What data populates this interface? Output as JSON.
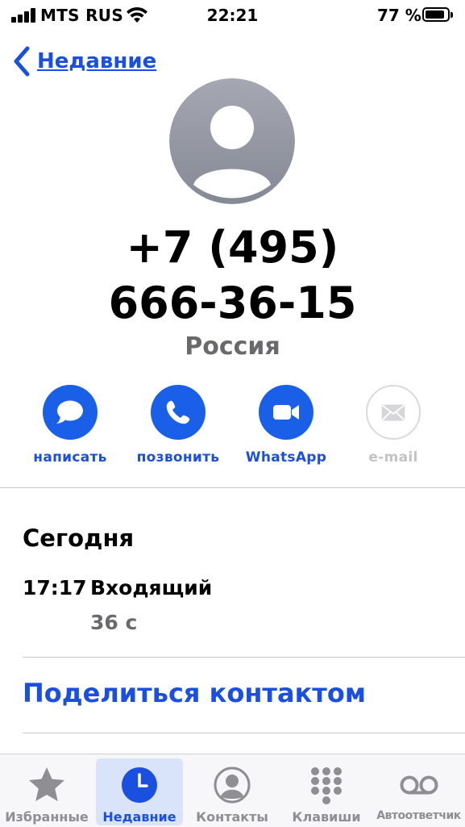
{
  "status_bar": {
    "carrier": "MTS RUS",
    "time": "22:21",
    "battery_percent": "77 %",
    "battery_level": 0.77
  },
  "nav": {
    "back_label": "Недавние"
  },
  "contact": {
    "phone_line1": "+7 (495)",
    "phone_line2": "666-36-15",
    "country": "Россия"
  },
  "actions": [
    {
      "label": "написать",
      "icon": "message-icon",
      "enabled": true
    },
    {
      "label": "позвонить",
      "icon": "phone-icon",
      "enabled": true
    },
    {
      "label": "WhatsApp",
      "icon": "video-icon",
      "enabled": true
    },
    {
      "label": "e-mail",
      "icon": "mail-icon",
      "enabled": false
    }
  ],
  "history": {
    "heading": "Сегодня",
    "entry": {
      "time": "17:17",
      "type": "Входящий",
      "duration": "36 с"
    }
  },
  "share_label": "Поделиться контактом",
  "tabbar": {
    "tabs": [
      {
        "label": "Избранные",
        "icon": "star-icon",
        "active": false
      },
      {
        "label": "Недавние",
        "icon": "clock-icon",
        "active": true
      },
      {
        "label": "Контакты",
        "icon": "person-circle-icon",
        "active": false
      },
      {
        "label": "Клавиши",
        "icon": "keypad-icon",
        "active": false
      },
      {
        "label": "Автоответчик",
        "icon": "voicemail-icon",
        "active": false
      }
    ]
  },
  "colors": {
    "accent": "#1a4fe0",
    "action_circle": "#1a5fe8",
    "secondary_text": "#6a6a6e",
    "inactive_tab": "#8e8e93"
  }
}
